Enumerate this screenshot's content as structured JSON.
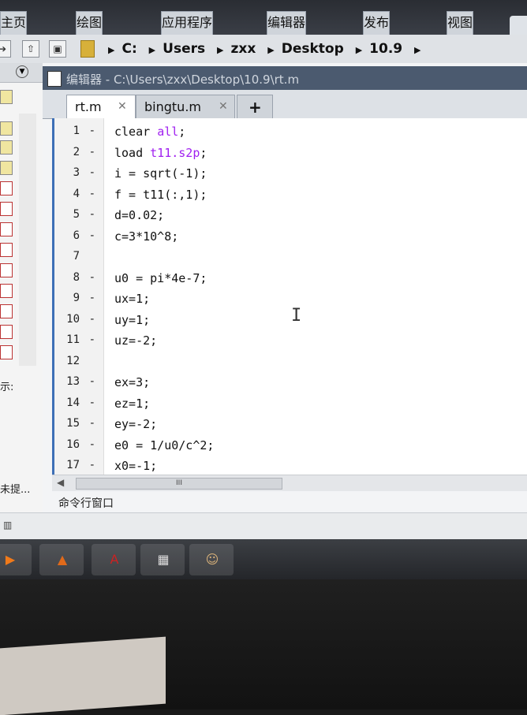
{
  "ribbon": {
    "tabs": [
      "主页",
      "绘图",
      "应用程序",
      "编辑器",
      "发布",
      "视图"
    ]
  },
  "address_bar": {
    "path": [
      "C:",
      "Users",
      "zxx",
      "Desktop",
      "10.9"
    ]
  },
  "left_panel": {
    "label_details": "示:",
    "label_status": "未提..."
  },
  "editor": {
    "title": "编辑器 - C:\\Users\\zxx\\Desktop\\10.9\\rt.m",
    "tabs": [
      {
        "name": "rt.m",
        "active": true
      },
      {
        "name": "bingtu.m",
        "active": false
      }
    ],
    "add_tab": "+",
    "lines": [
      {
        "num": "1",
        "mark": "-",
        "parts": [
          {
            "t": "clear "
          },
          {
            "t": "all",
            "s": true
          },
          {
            "t": ";"
          }
        ]
      },
      {
        "num": "2",
        "mark": "-",
        "parts": [
          {
            "t": "load "
          },
          {
            "t": "t11.s2p",
            "s": true
          },
          {
            "t": ";"
          }
        ]
      },
      {
        "num": "3",
        "mark": "-",
        "parts": [
          {
            "t": "i = sqrt(-1);"
          }
        ]
      },
      {
        "num": "4",
        "mark": "-",
        "parts": [
          {
            "t": "f = t11(:,1);"
          }
        ]
      },
      {
        "num": "5",
        "mark": "-",
        "parts": [
          {
            "t": "d=0.02;"
          }
        ]
      },
      {
        "num": "6",
        "mark": "-",
        "parts": [
          {
            "t": "c=3*10^8;"
          }
        ]
      },
      {
        "num": "7",
        "mark": "",
        "parts": []
      },
      {
        "num": "8",
        "mark": "-",
        "parts": [
          {
            "t": "u0 = pi*4e-7;"
          }
        ]
      },
      {
        "num": "9",
        "mark": "-",
        "parts": [
          {
            "t": "ux=1;"
          }
        ]
      },
      {
        "num": "10",
        "mark": "-",
        "parts": [
          {
            "t": "uy=1;"
          }
        ]
      },
      {
        "num": "11",
        "mark": "-",
        "parts": [
          {
            "t": "uz=-2;"
          }
        ]
      },
      {
        "num": "12",
        "mark": "",
        "parts": []
      },
      {
        "num": "13",
        "mark": "-",
        "parts": [
          {
            "t": "ex=3;"
          }
        ]
      },
      {
        "num": "14",
        "mark": "-",
        "parts": [
          {
            "t": "ez=1;"
          }
        ]
      },
      {
        "num": "15",
        "mark": "-",
        "parts": [
          {
            "t": "ey=-2;"
          }
        ]
      },
      {
        "num": "16",
        "mark": "-",
        "parts": [
          {
            "t": "e0 = 1/u0/c^2;"
          }
        ]
      },
      {
        "num": "17",
        "mark": "-",
        "parts": [
          {
            "t": "x0=-1;"
          }
        ]
      }
    ],
    "scroll_grip": "III"
  },
  "command_window": {
    "label": "命令行窗口"
  },
  "taskbar": {
    "apps": [
      {
        "name": "media-player",
        "glyph": "▶"
      },
      {
        "name": "matlab",
        "glyph": "▲"
      },
      {
        "name": "pdf-reader",
        "glyph": "A"
      },
      {
        "name": "calculator",
        "glyph": "▦"
      },
      {
        "name": "photo-viewer",
        "glyph": "☺"
      }
    ]
  },
  "colors": {
    "string": "#a020f0",
    "titlebar": "#4b5a6f",
    "gutter_marker": "#3d6fb6"
  }
}
